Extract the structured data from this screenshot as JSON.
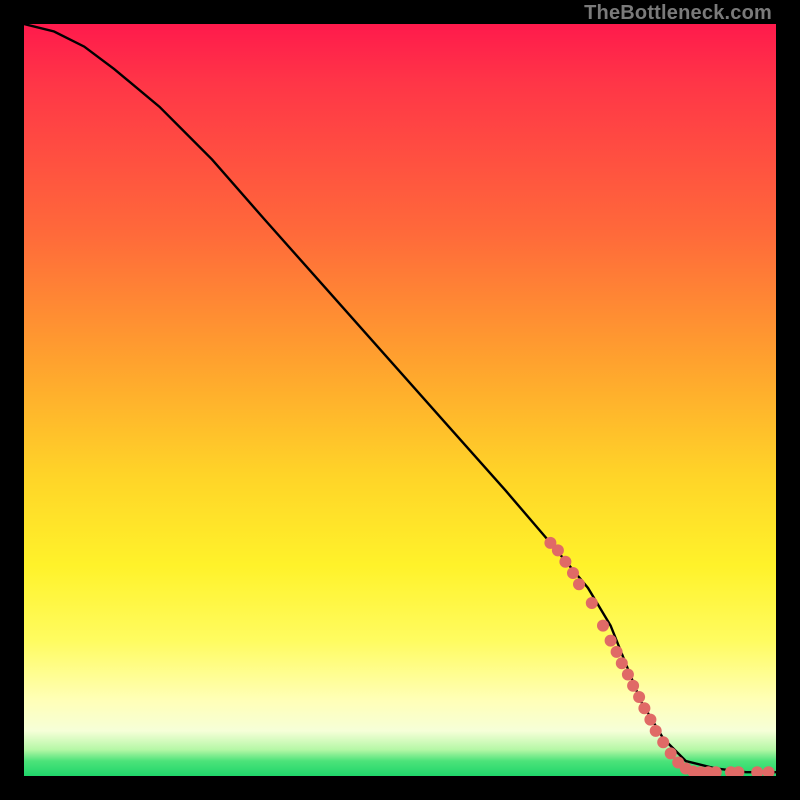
{
  "watermark": "TheBottleneck.com",
  "chart_data": {
    "type": "line",
    "title": "",
    "xlabel": "",
    "ylabel": "",
    "xlim": [
      0,
      100
    ],
    "ylim": [
      0,
      100
    ],
    "grid": false,
    "legend": false,
    "gradient_background": {
      "stops": [
        {
          "pos": 0,
          "color": "#ff1a4c"
        },
        {
          "pos": 28,
          "color": "#ff6a3a"
        },
        {
          "pos": 60,
          "color": "#ffd428"
        },
        {
          "pos": 82,
          "color": "#fffc60"
        },
        {
          "pos": 94,
          "color": "#f6ffd8"
        },
        {
          "pos": 98,
          "color": "#4de37a"
        },
        {
          "pos": 100,
          "color": "#1fd56a"
        }
      ]
    },
    "series": [
      {
        "name": "bottleneck-curve",
        "color": "#000000",
        "x": [
          0,
          4,
          8,
          12,
          18,
          25,
          32,
          40,
          48,
          56,
          64,
          70,
          75,
          78,
          80,
          82,
          85,
          88,
          92,
          96,
          100
        ],
        "y": [
          100,
          99,
          97,
          94,
          89,
          82,
          74,
          65,
          56,
          47,
          38,
          31,
          25,
          20,
          15,
          10,
          5,
          2,
          1,
          0.5,
          0.5
        ]
      }
    ],
    "points": {
      "name": "highlight-dots",
      "color": "#e06a66",
      "radius": 6,
      "data": [
        {
          "x": 70,
          "y": 31
        },
        {
          "x": 71,
          "y": 30
        },
        {
          "x": 72,
          "y": 28.5
        },
        {
          "x": 73,
          "y": 27
        },
        {
          "x": 73.8,
          "y": 25.5
        },
        {
          "x": 75.5,
          "y": 23
        },
        {
          "x": 77,
          "y": 20
        },
        {
          "x": 78,
          "y": 18
        },
        {
          "x": 78.8,
          "y": 16.5
        },
        {
          "x": 79.5,
          "y": 15
        },
        {
          "x": 80.3,
          "y": 13.5
        },
        {
          "x": 81,
          "y": 12
        },
        {
          "x": 81.8,
          "y": 10.5
        },
        {
          "x": 82.5,
          "y": 9
        },
        {
          "x": 83.3,
          "y": 7.5
        },
        {
          "x": 84,
          "y": 6
        },
        {
          "x": 85,
          "y": 4.5
        },
        {
          "x": 86,
          "y": 3
        },
        {
          "x": 87,
          "y": 1.8
        },
        {
          "x": 88,
          "y": 1
        },
        {
          "x": 89,
          "y": 0.6
        },
        {
          "x": 90,
          "y": 0.5
        },
        {
          "x": 91,
          "y": 0.5
        },
        {
          "x": 92,
          "y": 0.5
        },
        {
          "x": 94,
          "y": 0.5
        },
        {
          "x": 95,
          "y": 0.5
        },
        {
          "x": 97.5,
          "y": 0.5
        },
        {
          "x": 99,
          "y": 0.5
        }
      ]
    }
  }
}
